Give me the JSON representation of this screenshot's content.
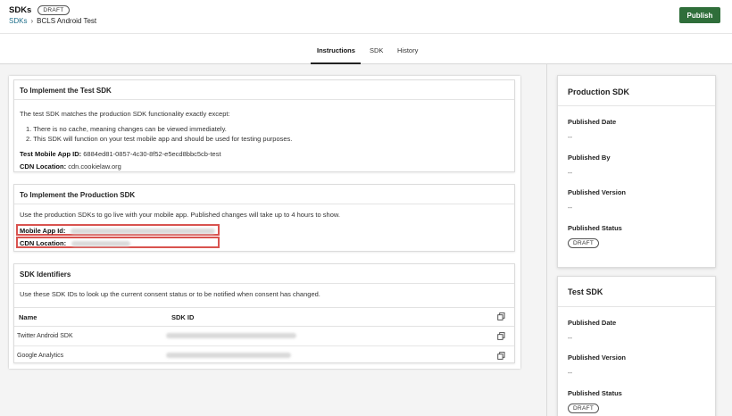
{
  "header": {
    "title": "SDKs",
    "status_badge": "DRAFT",
    "breadcrumb": {
      "parent": "SDKs",
      "current": "BCLS Android Test"
    },
    "publish_label": "Publish"
  },
  "tabs": [
    {
      "label": "Instructions",
      "active": true
    },
    {
      "label": "SDK",
      "active": false
    },
    {
      "label": "History",
      "active": false
    }
  ],
  "test_sdk_card": {
    "title": "To Implement the Test SDK",
    "intro": "The test SDK matches the production SDK functionality exactly except:",
    "list": [
      "1. There is no cache, meaning changes can be viewed immediately.",
      "2. This SDK will function on your test mobile app and should be used for testing purposes."
    ],
    "app_id_label": "Test Mobile App ID:",
    "app_id_value": "6884ed81-0857-4c30-8f52-e5ecd8bbc5cb-test",
    "cdn_label": "CDN Location:",
    "cdn_value": "cdn.cookielaw.org"
  },
  "prod_sdk_card": {
    "title": "To Implement the Production SDK",
    "intro": "Use the production SDKs to go live with your mobile app. Published changes will take up to 4 hours to show.",
    "app_id_label": "Mobile App Id:",
    "cdn_label": "CDN Location:"
  },
  "identifiers_card": {
    "title": "SDK Identifiers",
    "intro": "Use these SDK IDs to look up the current consent status or to be notified when consent has changed.",
    "columns": {
      "name": "Name",
      "sdk_id": "SDK ID"
    },
    "rows": [
      {
        "name": "Twitter Android SDK"
      },
      {
        "name": "Google Analytics"
      }
    ]
  },
  "production_panel": {
    "title": "Production SDK",
    "published_date_label": "Published Date",
    "published_date_value": "--",
    "published_by_label": "Published By",
    "published_by_value": "--",
    "published_version_label": "Published Version",
    "published_version_value": "--",
    "published_status_label": "Published Status",
    "published_status_value": "DRAFT"
  },
  "test_panel": {
    "title": "Test SDK",
    "published_date_label": "Published Date",
    "published_date_value": "--",
    "published_version_label": "Published Version",
    "published_version_value": "--",
    "published_status_label": "Published Status",
    "published_status_value": "DRAFT"
  },
  "icons": {
    "copy": "copy-icon",
    "breadcrumb_separator": "chevron-right-icon"
  },
  "colors": {
    "publish_button": "#2f6e3a",
    "link": "#1f6f8b",
    "highlight": "#d9534f"
  }
}
